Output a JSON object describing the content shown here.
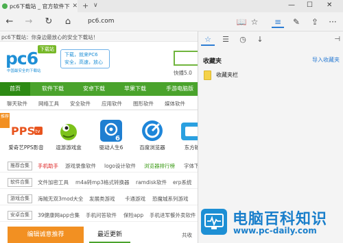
{
  "browser": {
    "tab_title": "pc6下载站 _ 官方软件下",
    "tab_close": "✕",
    "new_tab": "+",
    "tab_list": "∨",
    "minimize": "—",
    "maximize": "☐",
    "close": "✕",
    "back": "←",
    "forward": "→",
    "refresh": "↻",
    "home": "⌂",
    "address": "pc6.com",
    "reading_view": "📖",
    "favorite_star": "☆",
    "hub": "≡",
    "notes": "✎",
    "share": "⇪",
    "more": "···"
  },
  "page": {
    "top_strip": "pc6下载站：你身边最放心的安全下载站！",
    "logo_text": "pc6",
    "logo_badge": "下载站",
    "logo_sub": "中国最安全的下载站",
    "slogan": [
      "下载，就来PC6",
      "安全，高速，放心"
    ],
    "hot_search": "快播5.0",
    "menu": [
      "首页",
      "软件下载",
      "安卓下载",
      "苹果下载",
      "手游电脑版"
    ],
    "subnav": [
      "聊天软件",
      "网络工具",
      "安全软件",
      "应用软件",
      "图形软件",
      "媒体软件"
    ],
    "ribbon": "推荐",
    "apps": [
      {
        "label": "爱奇艺PPS影音",
        "icon": "pps-icon"
      },
      {
        "label": "逗游游戏盒",
        "icon": "dou-you-icon"
      },
      {
        "label": "驱动人生6",
        "icon": "driver-life-icon"
      },
      {
        "label": "百度浏览器",
        "icon": "baidu-browser-icon"
      },
      {
        "label": "东方输",
        "icon": "dongfang-icon"
      }
    ],
    "categories": [
      {
        "tag": "推荐合集",
        "links": [
          {
            "text": "手机助手",
            "style": "red"
          },
          {
            "text": "游戏录像软件",
            "style": ""
          },
          {
            "text": "logo设计软件",
            "style": ""
          },
          {
            "text": "浏览器排行榜",
            "style": "green"
          },
          {
            "text": "字体下",
            "style": ""
          }
        ]
      },
      {
        "tag": "软件合集",
        "links": [
          {
            "text": "文件加密工具",
            "style": ""
          },
          {
            "text": "m4a转mp3格式转换器",
            "style": ""
          },
          {
            "text": "ramdisk软件",
            "style": ""
          },
          {
            "text": "erp系统",
            "style": ""
          }
        ]
      },
      {
        "tag": "游戏合集",
        "links": [
          {
            "text": "海贼无双3mod大全",
            "style": ""
          },
          {
            "text": "发展类游戏",
            "style": ""
          },
          {
            "text": "卡通游戏",
            "style": ""
          },
          {
            "text": "恐魔城系列游戏",
            "style": ""
          }
        ]
      },
      {
        "tag": "安卓合集",
        "links": [
          {
            "text": "39健康网app合集",
            "style": ""
          },
          {
            "text": "手机问答软件",
            "style": ""
          },
          {
            "text": "保险app",
            "style": ""
          },
          {
            "text": "手机进军餐外卖软件",
            "style": ""
          }
        ]
      }
    ],
    "bottom_left": "编辑诚意推荐",
    "bottom_tab": "最近更新",
    "bottom_right": "共收"
  },
  "hub": {
    "tabs": [
      "☆",
      "☰",
      "◷",
      "↓"
    ],
    "pin": "⊣",
    "title": "收藏夹",
    "import": "导入收藏夹",
    "folder_label": "收藏夹栏"
  },
  "watermark": {
    "title": "电脑百科知识",
    "url": "www.pc-daily.com"
  },
  "colors": {
    "menu_green": "#4aa32c",
    "accent_blue": "#2b7cd3",
    "orange": "#f29022"
  }
}
